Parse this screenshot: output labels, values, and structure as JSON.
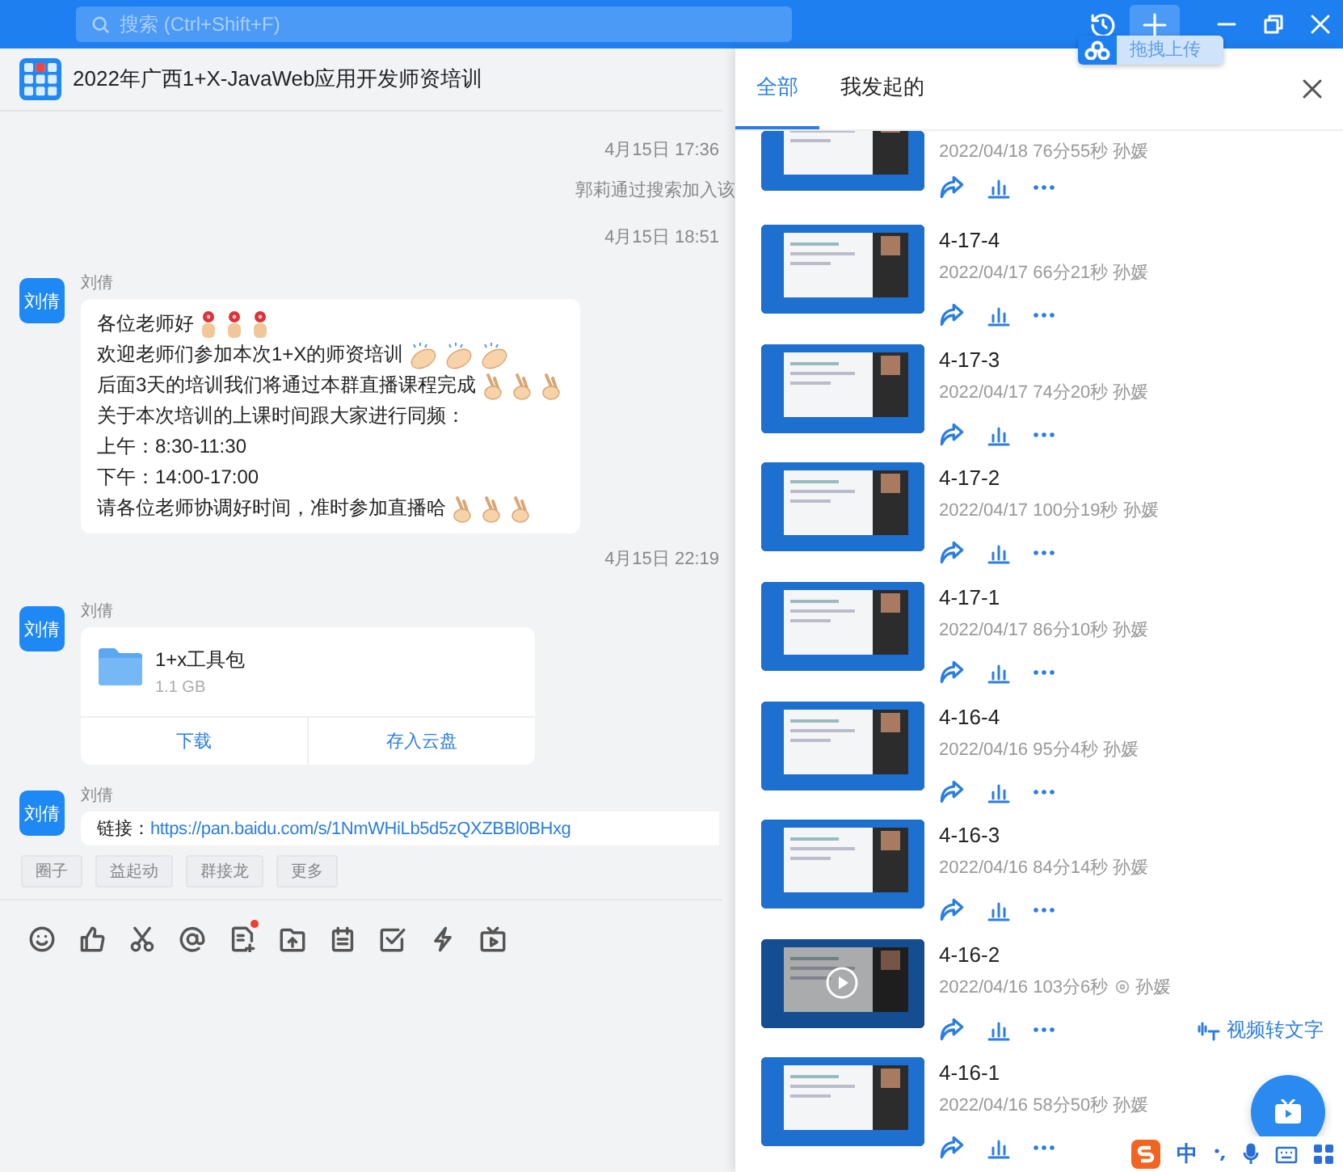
{
  "topbar": {
    "search": {
      "placeholder": "搜索 (Ctrl+Shift+F)"
    },
    "upload_tooltip": "拖拽上传"
  },
  "chat": {
    "title": "2022年广西1+X-JavaWeb应用开发师资培训",
    "items": [
      {
        "kind": "time",
        "text": "4月15日 17:36"
      },
      {
        "kind": "system",
        "text": "郭莉通过搜索加入该"
      },
      {
        "kind": "time",
        "text": "4月15日 18:51"
      },
      {
        "kind": "text",
        "avatar": "刘倩",
        "sender": "刘倩",
        "lines": [
          {
            "text": "各位老师好",
            "emojis": [
              {
                "kind": "flower"
              },
              {
                "kind": "flower"
              },
              {
                "kind": "flower"
              }
            ]
          },
          {
            "text": "欢迎老师们参加本次1+X的师资培训",
            "emojis": [
              {
                "kind": "clap"
              },
              {
                "kind": "clap"
              },
              {
                "kind": "clap"
              }
            ]
          },
          {
            "text": "后面3天的培训我们将通过本群直播课程完成",
            "emojis": [
              {
                "kind": "fingers"
              },
              {
                "kind": "fingers"
              },
              {
                "kind": "fingers"
              }
            ]
          },
          {
            "text": "关于本次培训的上课时间跟大家进行同频："
          },
          {
            "text": "上午：8:30-11:30"
          },
          {
            "text": "下午：14:00-17:00"
          },
          {
            "text": "请各位老师协调好时间，准时参加直播哈",
            "emojis": [
              {
                "kind": "fingers"
              },
              {
                "kind": "fingers"
              },
              {
                "kind": "fingers"
              }
            ]
          }
        ]
      },
      {
        "kind": "time",
        "text": "4月15日 22:19"
      },
      {
        "kind": "file",
        "avatar": "刘倩",
        "sender": "刘倩",
        "file_name": "1+x工具包",
        "size": "1.1 GB",
        "actions": [
          "下载",
          "存入云盘"
        ]
      },
      {
        "kind": "link",
        "avatar": "刘倩",
        "sender": "刘倩",
        "label": "链接：",
        "url": "https://pan.baidu.com/s/1NmWHiLb5d5zQXZBBl0BHxg"
      }
    ],
    "quick_replies": [
      "圈子",
      "益起动",
      "群接龙",
      "更多"
    ]
  },
  "panel": {
    "tabs": [
      {
        "label": "全部",
        "selected": true
      },
      {
        "label": "我发起的",
        "selected": false
      }
    ],
    "videos": [
      {
        "meta": "2022/04/18 76分55秒 孙媛",
        "hovered": false
      },
      {
        "title": "4-17-4",
        "meta": "2022/04/17 66分21秒 孙媛",
        "hovered": false
      },
      {
        "title": "4-17-3",
        "meta": "2022/04/17 74分20秒 孙媛",
        "hovered": false
      },
      {
        "title": "4-17-2",
        "meta": "2022/04/17 100分19秒 孙媛",
        "hovered": false
      },
      {
        "title": "4-17-1",
        "meta": "2022/04/17 86分10秒 孙媛",
        "hovered": false
      },
      {
        "title": "4-16-4",
        "meta": "2022/04/16 95分4秒 孙媛",
        "hovered": false
      },
      {
        "title": "4-16-3",
        "meta": "2022/04/16 84分14秒 孙媛",
        "hovered": false
      },
      {
        "title": "4-16-2",
        "meta": "2022/04/16 103分6秒",
        "author": "孙媛",
        "hovered": true,
        "convert_action": "视频转文字"
      },
      {
        "title": "4-16-1",
        "meta": "2022/04/16 58分50秒 孙媛",
        "hovered": false
      }
    ]
  },
  "ime": {
    "mode": "中"
  }
}
